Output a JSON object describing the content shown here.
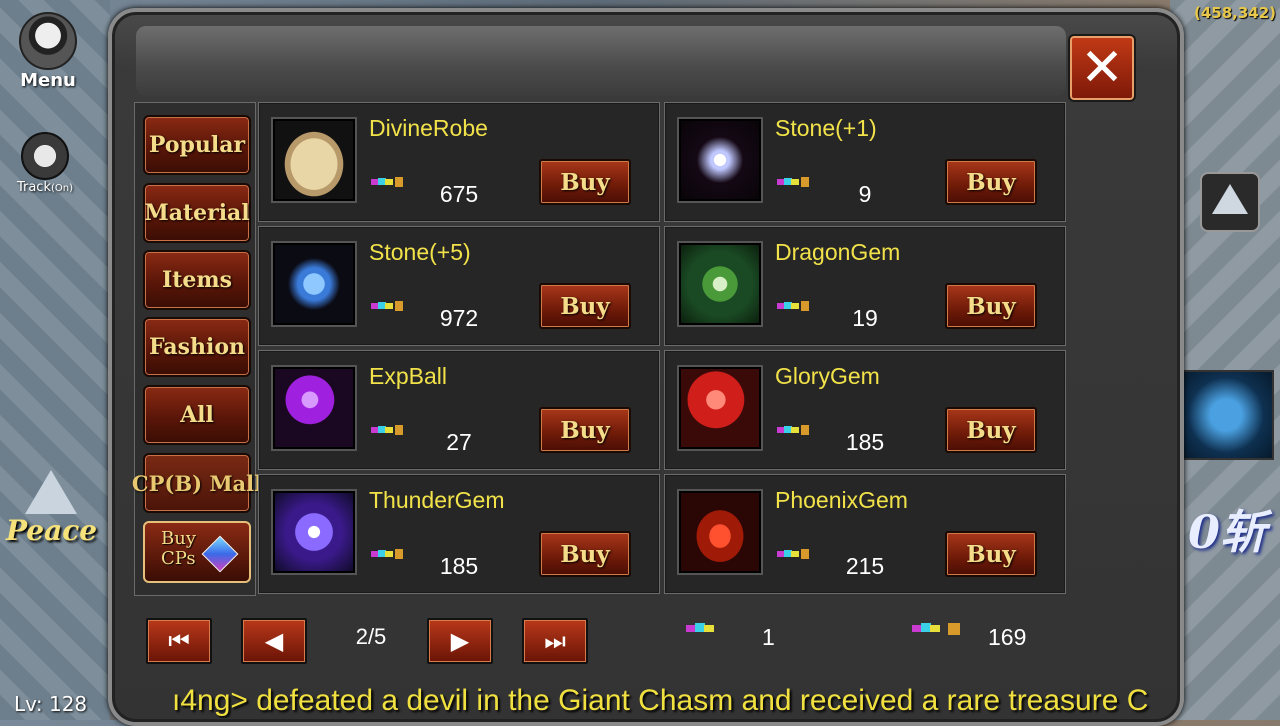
{
  "hud": {
    "menu_label": "Menu",
    "track_label": "Track",
    "track_sub": "(On)",
    "mode_label": "Peace",
    "coords": "(458,342)",
    "level": "Lv: 128",
    "right_badge": "0斩",
    "ticker": "ı4ng> defeated a devil in the Giant Chasm and received a rare treasure C"
  },
  "shop": {
    "close_label": "✕",
    "categories": [
      {
        "label": "Popular"
      },
      {
        "label": "Material"
      },
      {
        "label": "Items"
      },
      {
        "label": "Fashion"
      },
      {
        "label": "All"
      },
      {
        "label": "CP(B) Mall"
      }
    ],
    "buy_cps_line1": "Buy",
    "buy_cps_line2": "CPs",
    "buy_label": "Buy",
    "items": [
      {
        "name": "DivineRobe",
        "price": "675",
        "icon": "robe-icon"
      },
      {
        "name": "Stone(+1)",
        "price": "9",
        "icon": "stone-diamond-icon"
      },
      {
        "name": "Stone(+5)",
        "price": "972",
        "icon": "stone-blue-icon"
      },
      {
        "name": "DragonGem",
        "price": "19",
        "icon": "dragon-gem-icon"
      },
      {
        "name": "ExpBall",
        "price": "27",
        "icon": "exp-ball-icon"
      },
      {
        "name": "GloryGem",
        "price": "185",
        "icon": "glory-gem-icon"
      },
      {
        "name": "ThunderGem",
        "price": "185",
        "icon": "thunder-gem-icon"
      },
      {
        "name": "PhoenixGem",
        "price": "215",
        "icon": "phoenix-gem-icon"
      }
    ],
    "pagination": {
      "page": "2/5"
    },
    "balances": {
      "cps": "1",
      "bound_cps": "169"
    }
  }
}
